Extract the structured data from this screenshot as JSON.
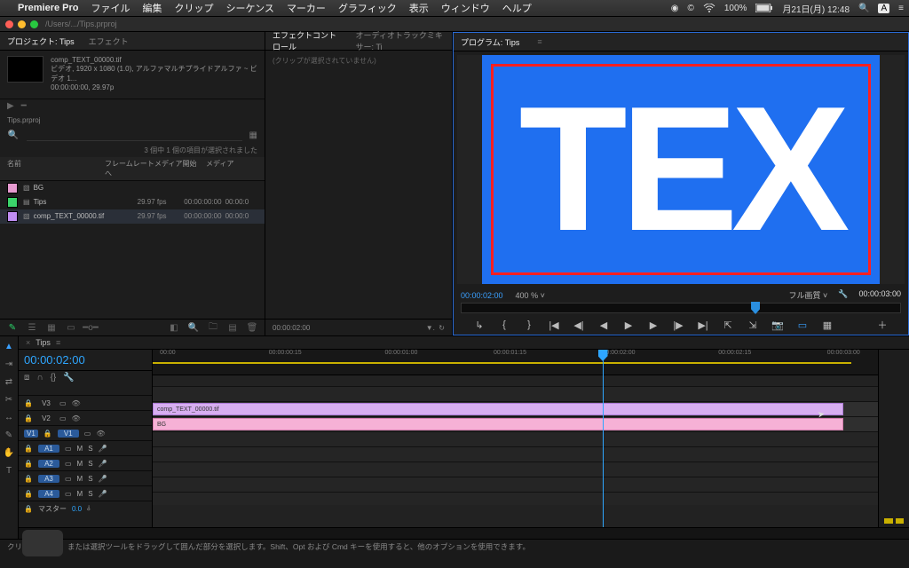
{
  "menubar": {
    "apple": "",
    "app": "Premiere Pro",
    "items": [
      "ファイル",
      "編集",
      "クリップ",
      "シーケンス",
      "マーカー",
      "グラフィック",
      "表示",
      "ウィンドウ",
      "ヘルプ"
    ],
    "right": {
      "rec": "◉",
      "cc": "©",
      "wifi": "wifi",
      "battery": "100%",
      "batt_pct": "██",
      "date": "月21日(月) 12:48",
      "search": "◯",
      "lang": "A",
      "user": "⋮≡"
    }
  },
  "titlebar": {
    "path": "/Users/.../Tips.prproj"
  },
  "project": {
    "tabs": [
      "プロジェクト: Tips",
      "エフェクト"
    ],
    "selected_clip": {
      "name": "comp_TEXT_00000.tif",
      "meta1": "ビデオ, 1920 x 1080 (1.0), アルファマルチプライドアルファ ~ ビデオ 1...",
      "meta2": "00:00:00:00, 29.97p"
    },
    "proj_file": "Tips.prproj",
    "selection": "3 個中 1 個の項目が選択されました",
    "cols": {
      "name": "名前",
      "fps": "フレームレート へ",
      "start": "メディア開始",
      "end": "メディア"
    },
    "rows": [
      {
        "color": "#e69ad0",
        "name": "BG",
        "fps": "",
        "start": "",
        "end": ""
      },
      {
        "color": "#3bd46a",
        "name": "Tips",
        "fps": "29.97 fps",
        "start": "00:00:00:00",
        "end": "00:00:0"
      },
      {
        "color": "#c08df2",
        "name": "comp_TEXT_00000.tif",
        "fps": "29.97 fps",
        "start": "00:00:00:00",
        "end": "00:00:0"
      }
    ]
  },
  "effect": {
    "tabs": [
      "エフェクトコントロール",
      "オーディオトラックミキサー: Ti"
    ],
    "placeholder": "(クリップが選択されていません)",
    "foot_tc": "00:00:02:00"
  },
  "program": {
    "tab": "プログラム: Tips",
    "overlay_text": "TEX",
    "tc_left": "00:00:02:00",
    "zoom": "400 %",
    "res": "フル画質",
    "tc_right": "00:00:03:00"
  },
  "timeline": {
    "seq": "Tips",
    "tc": "00:00:02:00",
    "ruler": [
      "00:00",
      "00:00:00:15",
      "00:00:01:00",
      "00:00:01:15",
      "00:00:02:00",
      "00:00:02:15",
      "00:00:03:00"
    ],
    "videoTracks": [
      {
        "id": "V3",
        "clip": null
      },
      {
        "id": "V2",
        "clip": {
          "label": "comp_TEXT_00000.tif",
          "cls": "lav"
        }
      },
      {
        "id": "V1",
        "clip": {
          "label": "BG",
          "cls": "pink"
        },
        "target": true
      }
    ],
    "audioTracks": [
      {
        "id": "A1"
      },
      {
        "id": "A2"
      },
      {
        "id": "A3"
      },
      {
        "id": "A4"
      }
    ],
    "master": {
      "label": "マスター",
      "val": "0.0"
    }
  },
  "status": "クリックで選択、または選択ツールをドラッグして囲んだ部分を選択します。Shift、Opt および Cmd キーを使用すると、他のオプションを使用できます。"
}
